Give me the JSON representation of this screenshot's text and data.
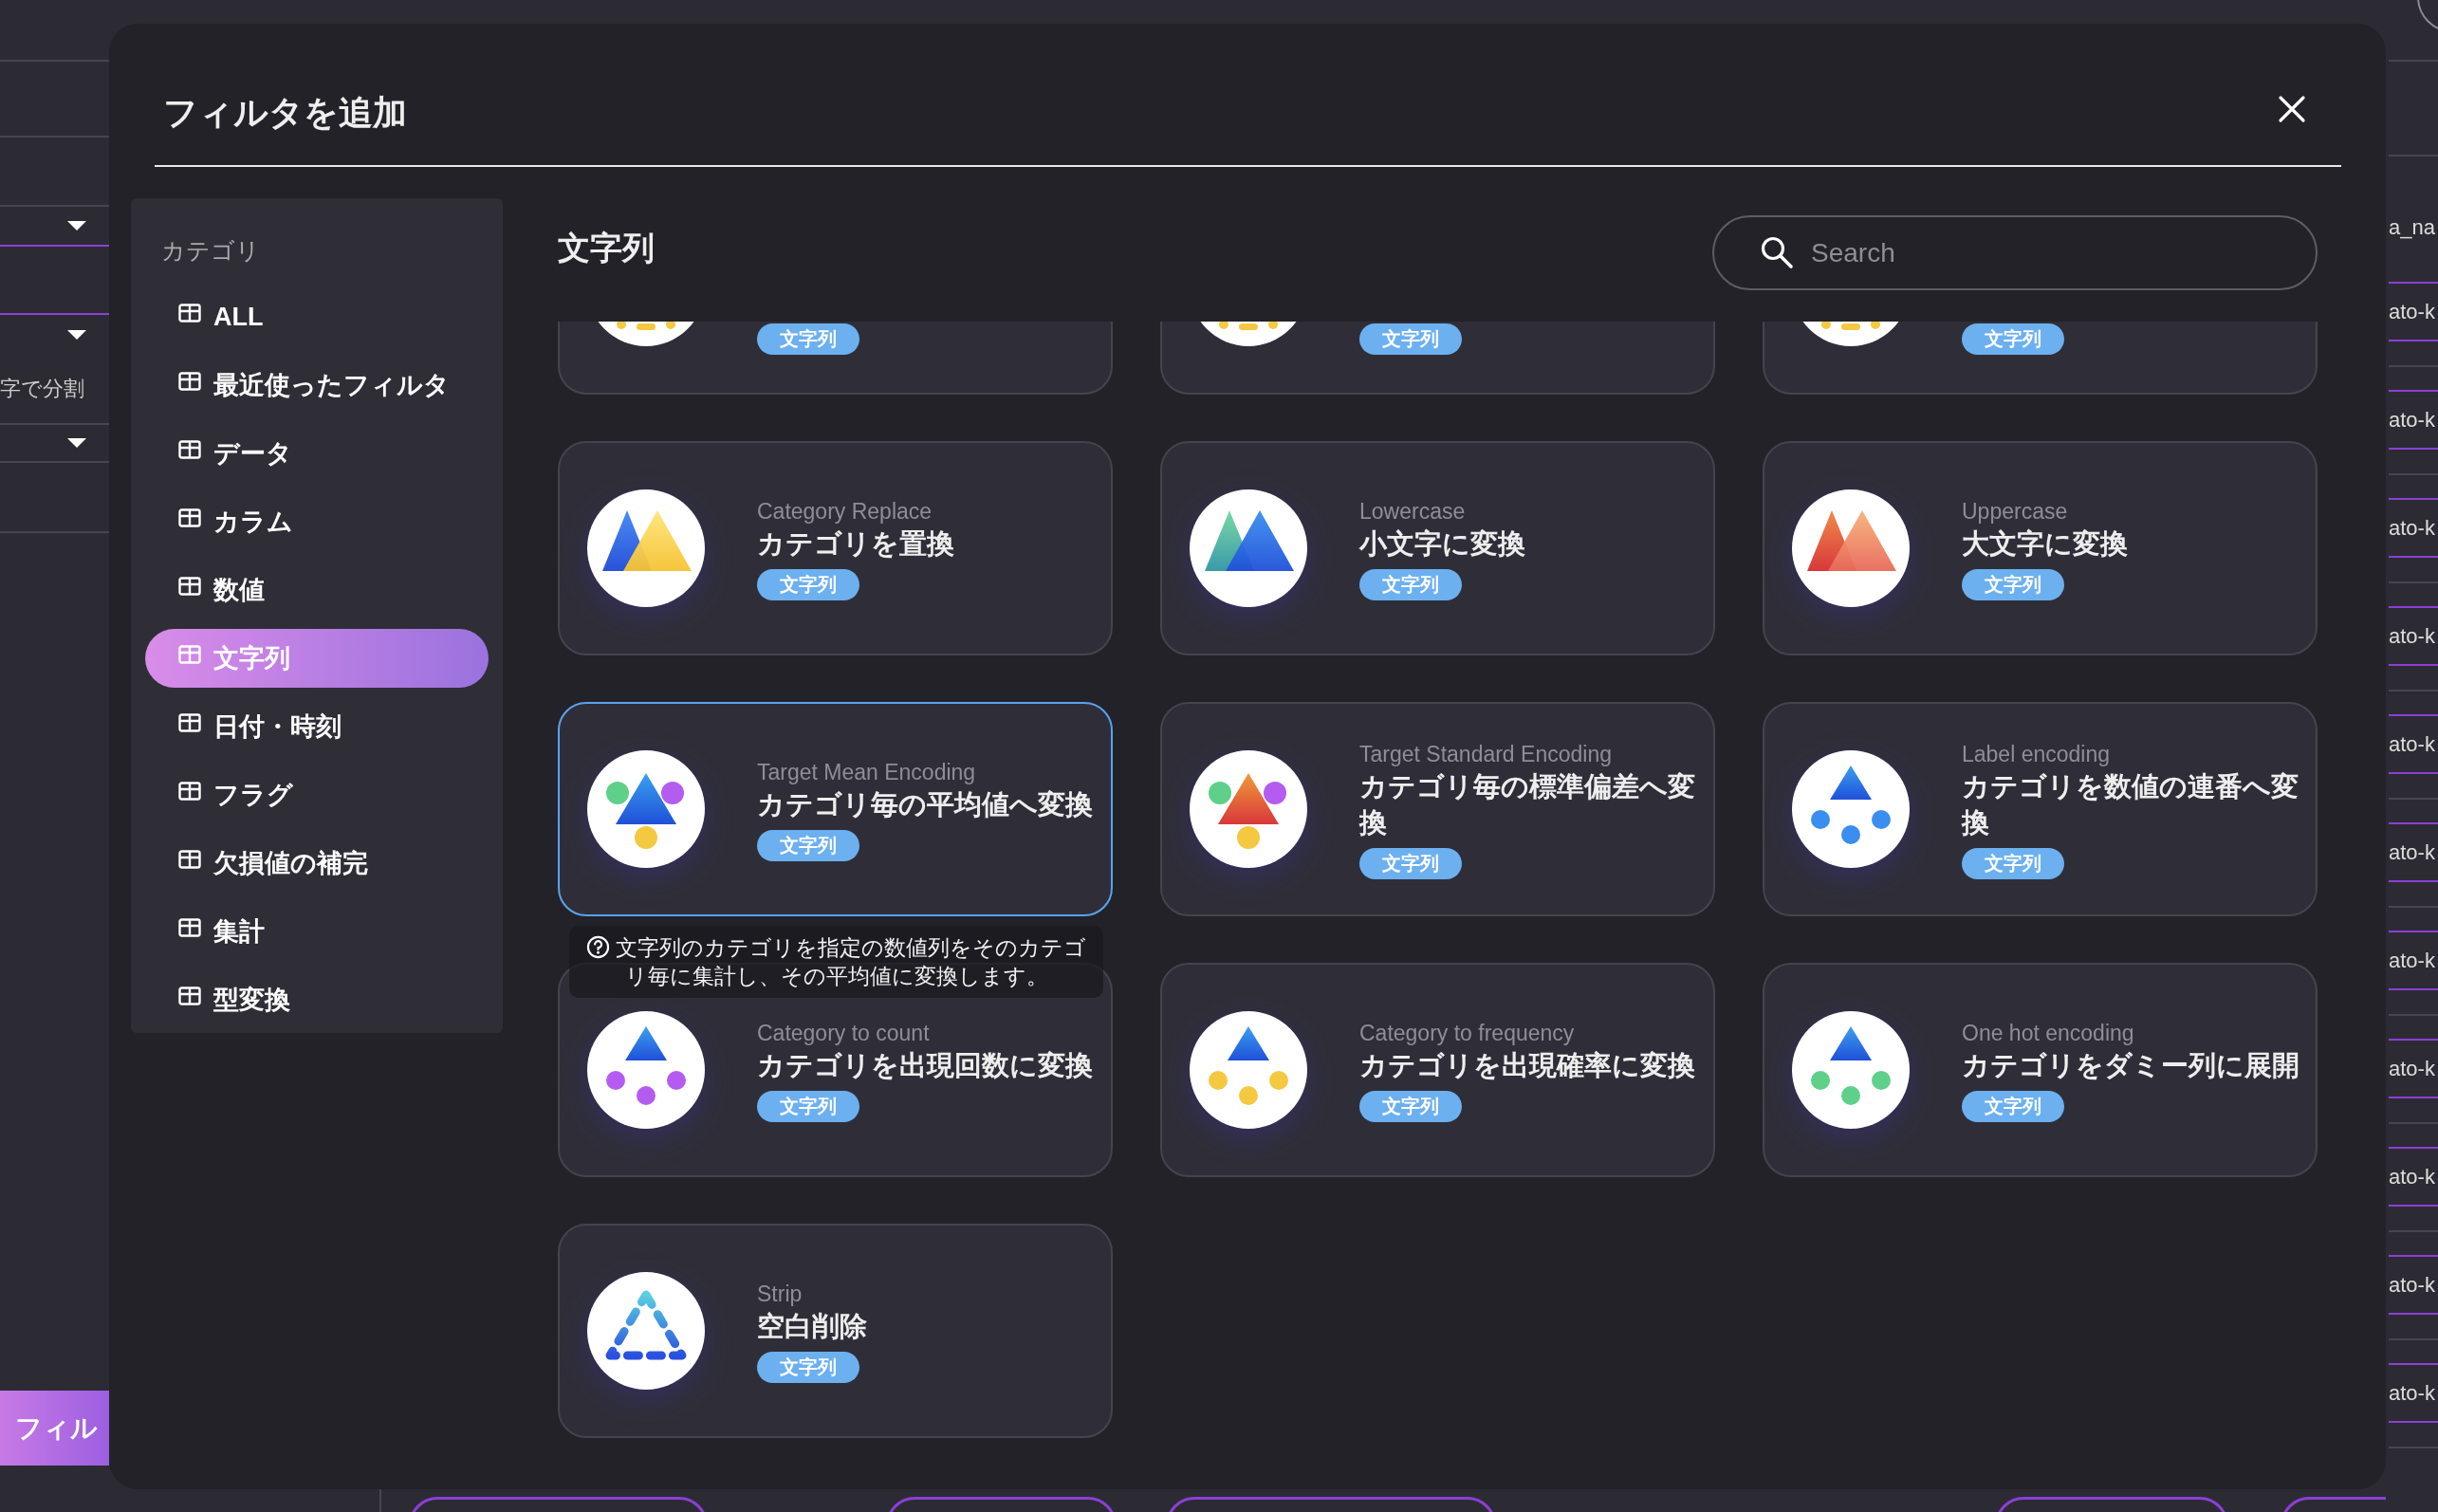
{
  "background": {
    "left_panel": {
      "text": "字で分割",
      "button": "フィル"
    },
    "right_panel": {
      "header": "a_na",
      "rows": [
        "ato-k",
        "ato-k",
        "ato-k",
        "ato-k",
        "ato-k",
        "ato-k",
        "ato-k",
        "ato-k",
        "ato-k",
        "ato-k",
        "ato-k"
      ]
    }
  },
  "dialog": {
    "title": "フィルタを追加",
    "sidebar": {
      "heading": "カテゴリ",
      "items": [
        {
          "label": "ALL",
          "selected": false
        },
        {
          "label": "最近使ったフィルタ",
          "selected": false
        },
        {
          "label": "データ",
          "selected": false
        },
        {
          "label": "カラム",
          "selected": false
        },
        {
          "label": "数値",
          "selected": false
        },
        {
          "label": "文字列",
          "selected": true
        },
        {
          "label": "日付・時刻",
          "selected": false
        },
        {
          "label": "フラグ",
          "selected": false
        },
        {
          "label": "欠損値の補完",
          "selected": false
        },
        {
          "label": "集計",
          "selected": false
        },
        {
          "label": "型変換",
          "selected": false
        }
      ]
    },
    "section_title": "文字列",
    "search": {
      "placeholder": "Search"
    },
    "cards": [
      {
        "kind": "partial",
        "tag": "文字列",
        "hovered": false
      },
      {
        "kind": "partial",
        "tag": "文字列",
        "hovered": false
      },
      {
        "kind": "partial",
        "tag": "文字列",
        "hovered": false
      },
      {
        "kind": "full",
        "en": "Category Replace",
        "title": "カテゴリを置換",
        "tag": "文字列",
        "hovered": false
      },
      {
        "kind": "full",
        "en": "Lowercase",
        "title": "小文字に変換",
        "tag": "文字列",
        "hovered": false
      },
      {
        "kind": "full",
        "en": "Uppercase",
        "title": "大文字に変換",
        "tag": "文字列",
        "hovered": false
      },
      {
        "kind": "full",
        "en": "Target Mean Encoding",
        "title": "カテゴリ毎の平均値へ変換",
        "tag": "文字列",
        "hovered": true,
        "tooltip": "文字列のカテゴリを指定の数値列をそのカテゴリ毎に集計し、その平均値に変換します。"
      },
      {
        "kind": "full",
        "en": "Target Standard Encoding",
        "title": "カテゴリ毎の標準偏差へ変換",
        "tag": "文字列",
        "hovered": false
      },
      {
        "kind": "full",
        "en": "Label encoding",
        "title": "カテゴリを数値の連番へ変換",
        "tag": "文字列",
        "hovered": false
      },
      {
        "kind": "full",
        "en": "Category to count",
        "title": "カテゴリを出現回数に変換",
        "tag": "文字列",
        "hovered": false
      },
      {
        "kind": "full",
        "en": "Category to frequency",
        "title": "カテゴリを出現確率に変換",
        "tag": "文字列",
        "hovered": false
      },
      {
        "kind": "full",
        "en": "One hot encoding",
        "title": "カテゴリをダミー列に展開",
        "tag": "文字列",
        "hovered": false
      },
      {
        "kind": "full",
        "en": "Strip",
        "title": "空白削除",
        "tag": "文字列",
        "hovered": false
      }
    ]
  }
}
